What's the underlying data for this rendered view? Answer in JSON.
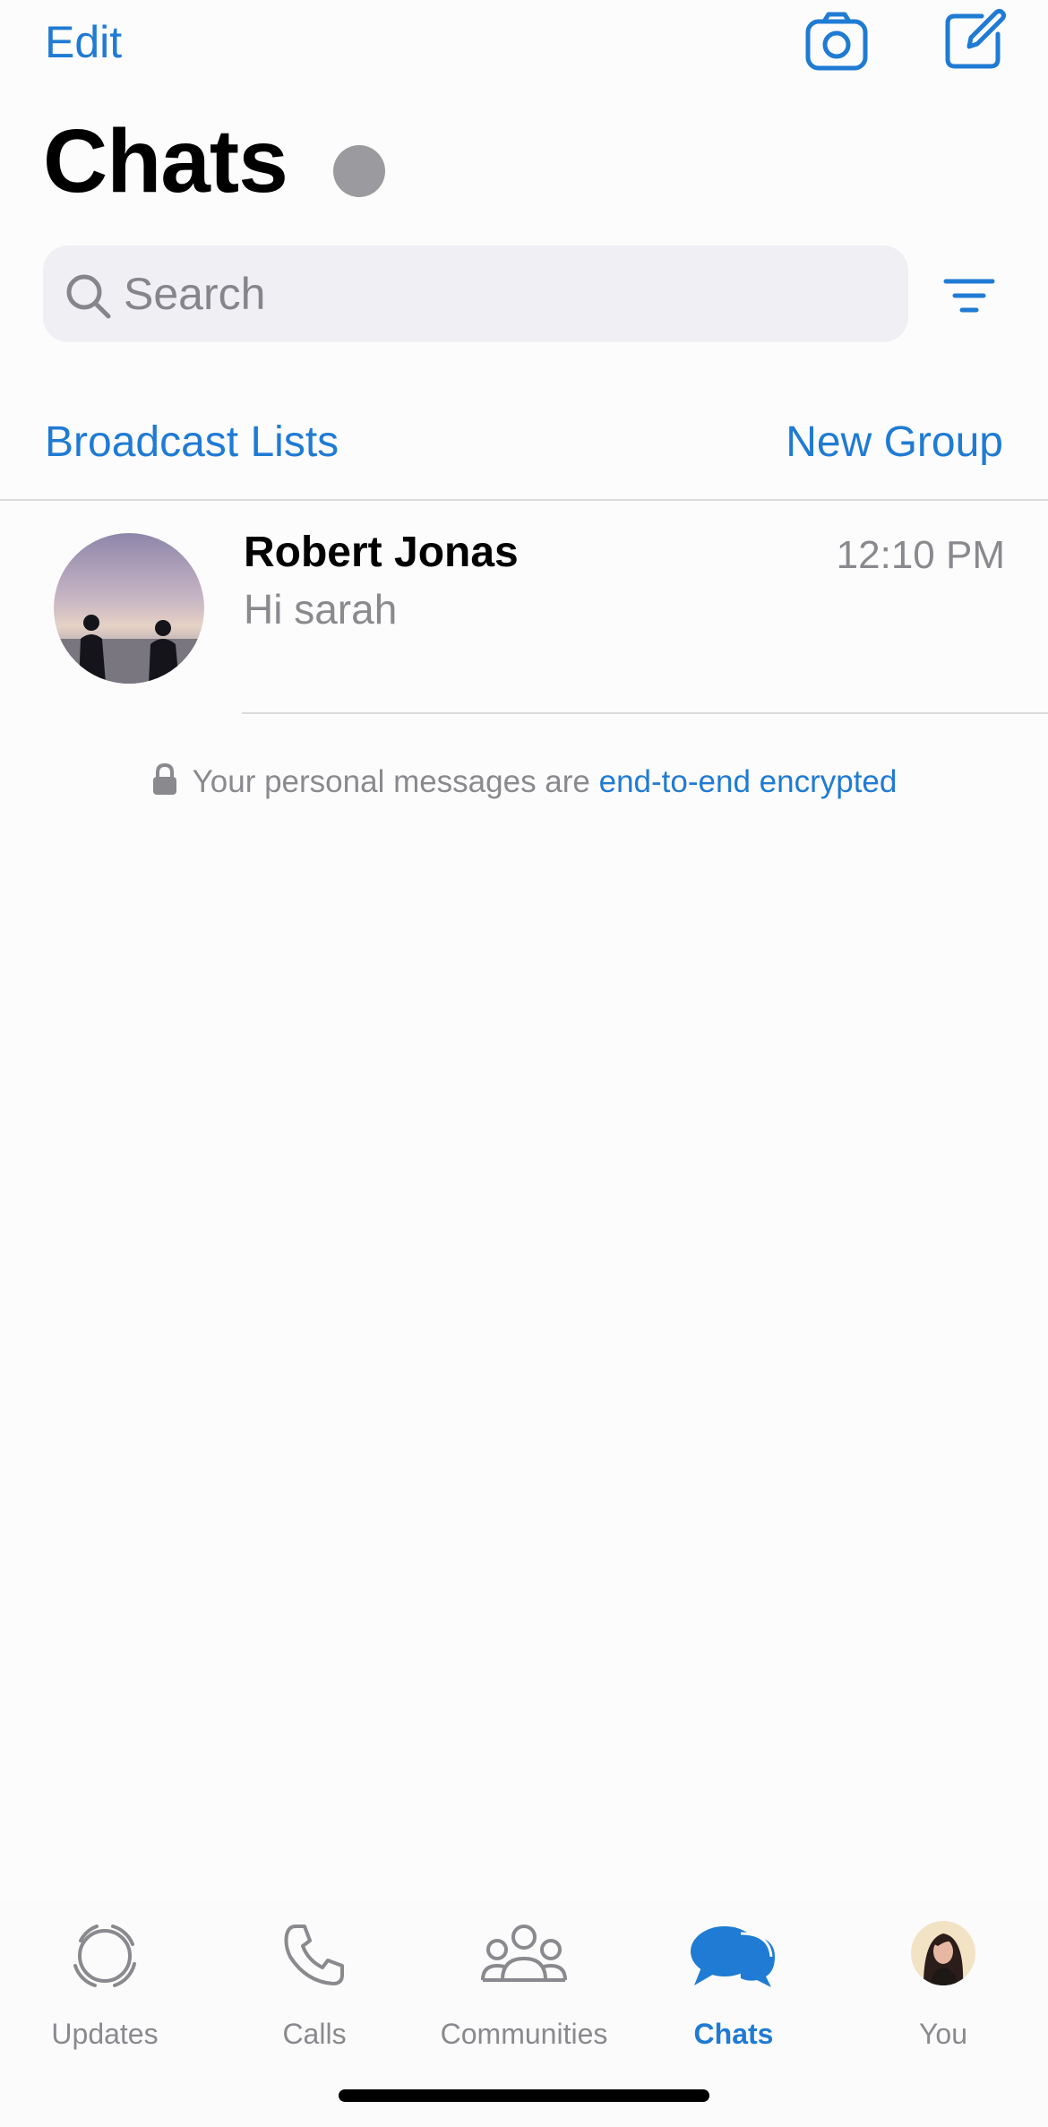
{
  "nav": {
    "edit_label": "Edit",
    "camera_icon": "camera-icon",
    "compose_icon": "compose-icon"
  },
  "header": {
    "title": "Chats"
  },
  "search": {
    "placeholder": "Search",
    "value": ""
  },
  "actions": {
    "broadcast_label": "Broadcast Lists",
    "new_group_label": "New Group"
  },
  "chats": [
    {
      "name": "Robert Jonas",
      "preview": "Hi sarah",
      "time": "12:10 PM"
    }
  ],
  "encryption": {
    "text": "Your personal messages are ",
    "link": "end-to-end encrypted"
  },
  "tabs": [
    {
      "label": "Updates",
      "icon": "updates-icon",
      "active": false
    },
    {
      "label": "Calls",
      "icon": "phone-icon",
      "active": false
    },
    {
      "label": "Communities",
      "icon": "communities-icon",
      "active": false
    },
    {
      "label": "Chats",
      "icon": "chats-icon",
      "active": true
    },
    {
      "label": "You",
      "icon": "profile-avatar",
      "active": false
    }
  ],
  "colors": {
    "accent": "#1f7bd3",
    "secondary_text": "#8a898e",
    "search_bg": "#f0eff4",
    "status_dot": "#9b9a9e"
  }
}
